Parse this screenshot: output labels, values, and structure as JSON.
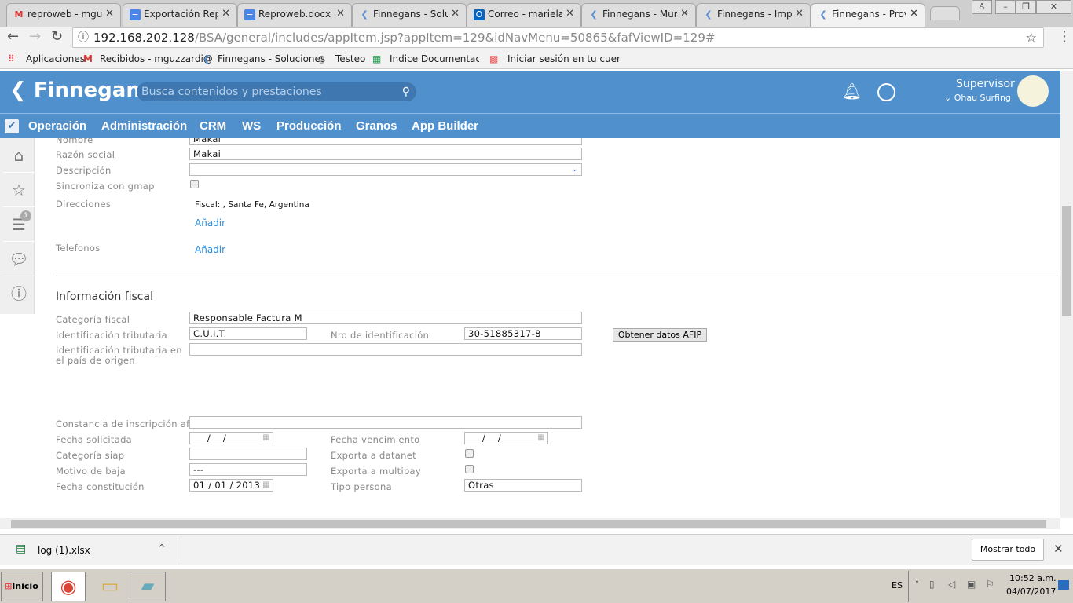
{
  "browser": {
    "tabs": [
      {
        "label": "reproweb - mguzz",
        "icon": "gmail-icon"
      },
      {
        "label": "Exportación Repro",
        "icon": "docs-icon"
      },
      {
        "label": "Reproweb.docx -",
        "icon": "docs-icon"
      },
      {
        "label": "Finnegans - Soluc",
        "icon": "finnegans-icon"
      },
      {
        "label": "Correo - mariela.g",
        "icon": "outlook-icon"
      },
      {
        "label": "Finnegans - Muro",
        "icon": "finnegans-icon"
      },
      {
        "label": "Finnegans - Impor",
        "icon": "finnegans-icon"
      },
      {
        "label": "Finnegans - Prove",
        "icon": "finnegans-icon",
        "active": true
      }
    ],
    "url_host": "192.168.202.128",
    "url_path": "/BSA/general/includes/appItem.jsp?appItem=129&idNavMenu=50865&fafViewID=129#",
    "bookmarks": [
      "Aplicaciones",
      "Recibidos - mguzzardi@",
      "Finnegans - Soluciones",
      "Testeo",
      "Indice Documentación S",
      "Iniciar sesión en tu cuer"
    ]
  },
  "app": {
    "logo": "Finnegans",
    "search_placeholder": "Busca contenidos y prestaciones",
    "user": "Supervisor",
    "company": "Ohau Surfing",
    "nav": [
      "Operación",
      "Administración",
      "CRM",
      "WS",
      "Producción",
      "Granos",
      "App Builder"
    ],
    "sidebar_badge": "1"
  },
  "form": {
    "nombre_label": "Nombre",
    "nombre": "Makai",
    "razon_label": "Razón social",
    "razon": "Makai",
    "descripcion_label": "Descripción",
    "gmap_label": "Sincroniza con gmap",
    "direcciones_label": "Direcciones",
    "direccion": "Fiscal: , Santa Fe, Argentina",
    "anadir": "Añadir",
    "telefonos_label": "Telefonos",
    "fiscal_title": "Información fiscal",
    "categoria_label": "Categoría fiscal",
    "categoria": "Responsable Factura M",
    "idtrib_label": "Identificación tributaria",
    "idtrib": "C.U.I.T.",
    "nroid_label": "Nro de identificación",
    "nroid": "30-51885317-8",
    "afip_button": "Obtener datos AFIP",
    "idorigen_label": "Identificación tributaria en el país de origen",
    "constancia_label": "Constancia de inscripción afip",
    "fsolicitada_label": "Fecha solicitada",
    "fsolicitada": "  /    /",
    "fvenc_label": "Fecha vencimiento",
    "fvenc": "  /    /",
    "siap_label": "Categoría siap",
    "datanet_label": "Exporta a datanet",
    "baja_label": "Motivo de baja",
    "baja": "---",
    "multipay_label": "Exporta a multipay",
    "fconst_label": "Fecha constitución",
    "fconst": "01 / 01 / 2013",
    "tipo_label": "Tipo persona",
    "tipo": "Otras"
  },
  "downloads": {
    "file": "log (1).xlsx",
    "show_all": "Mostrar todo"
  },
  "taskbar": {
    "start": "Inicio",
    "lang": "ES",
    "time": "10:52 a.m.",
    "date": "04/07/2017"
  }
}
